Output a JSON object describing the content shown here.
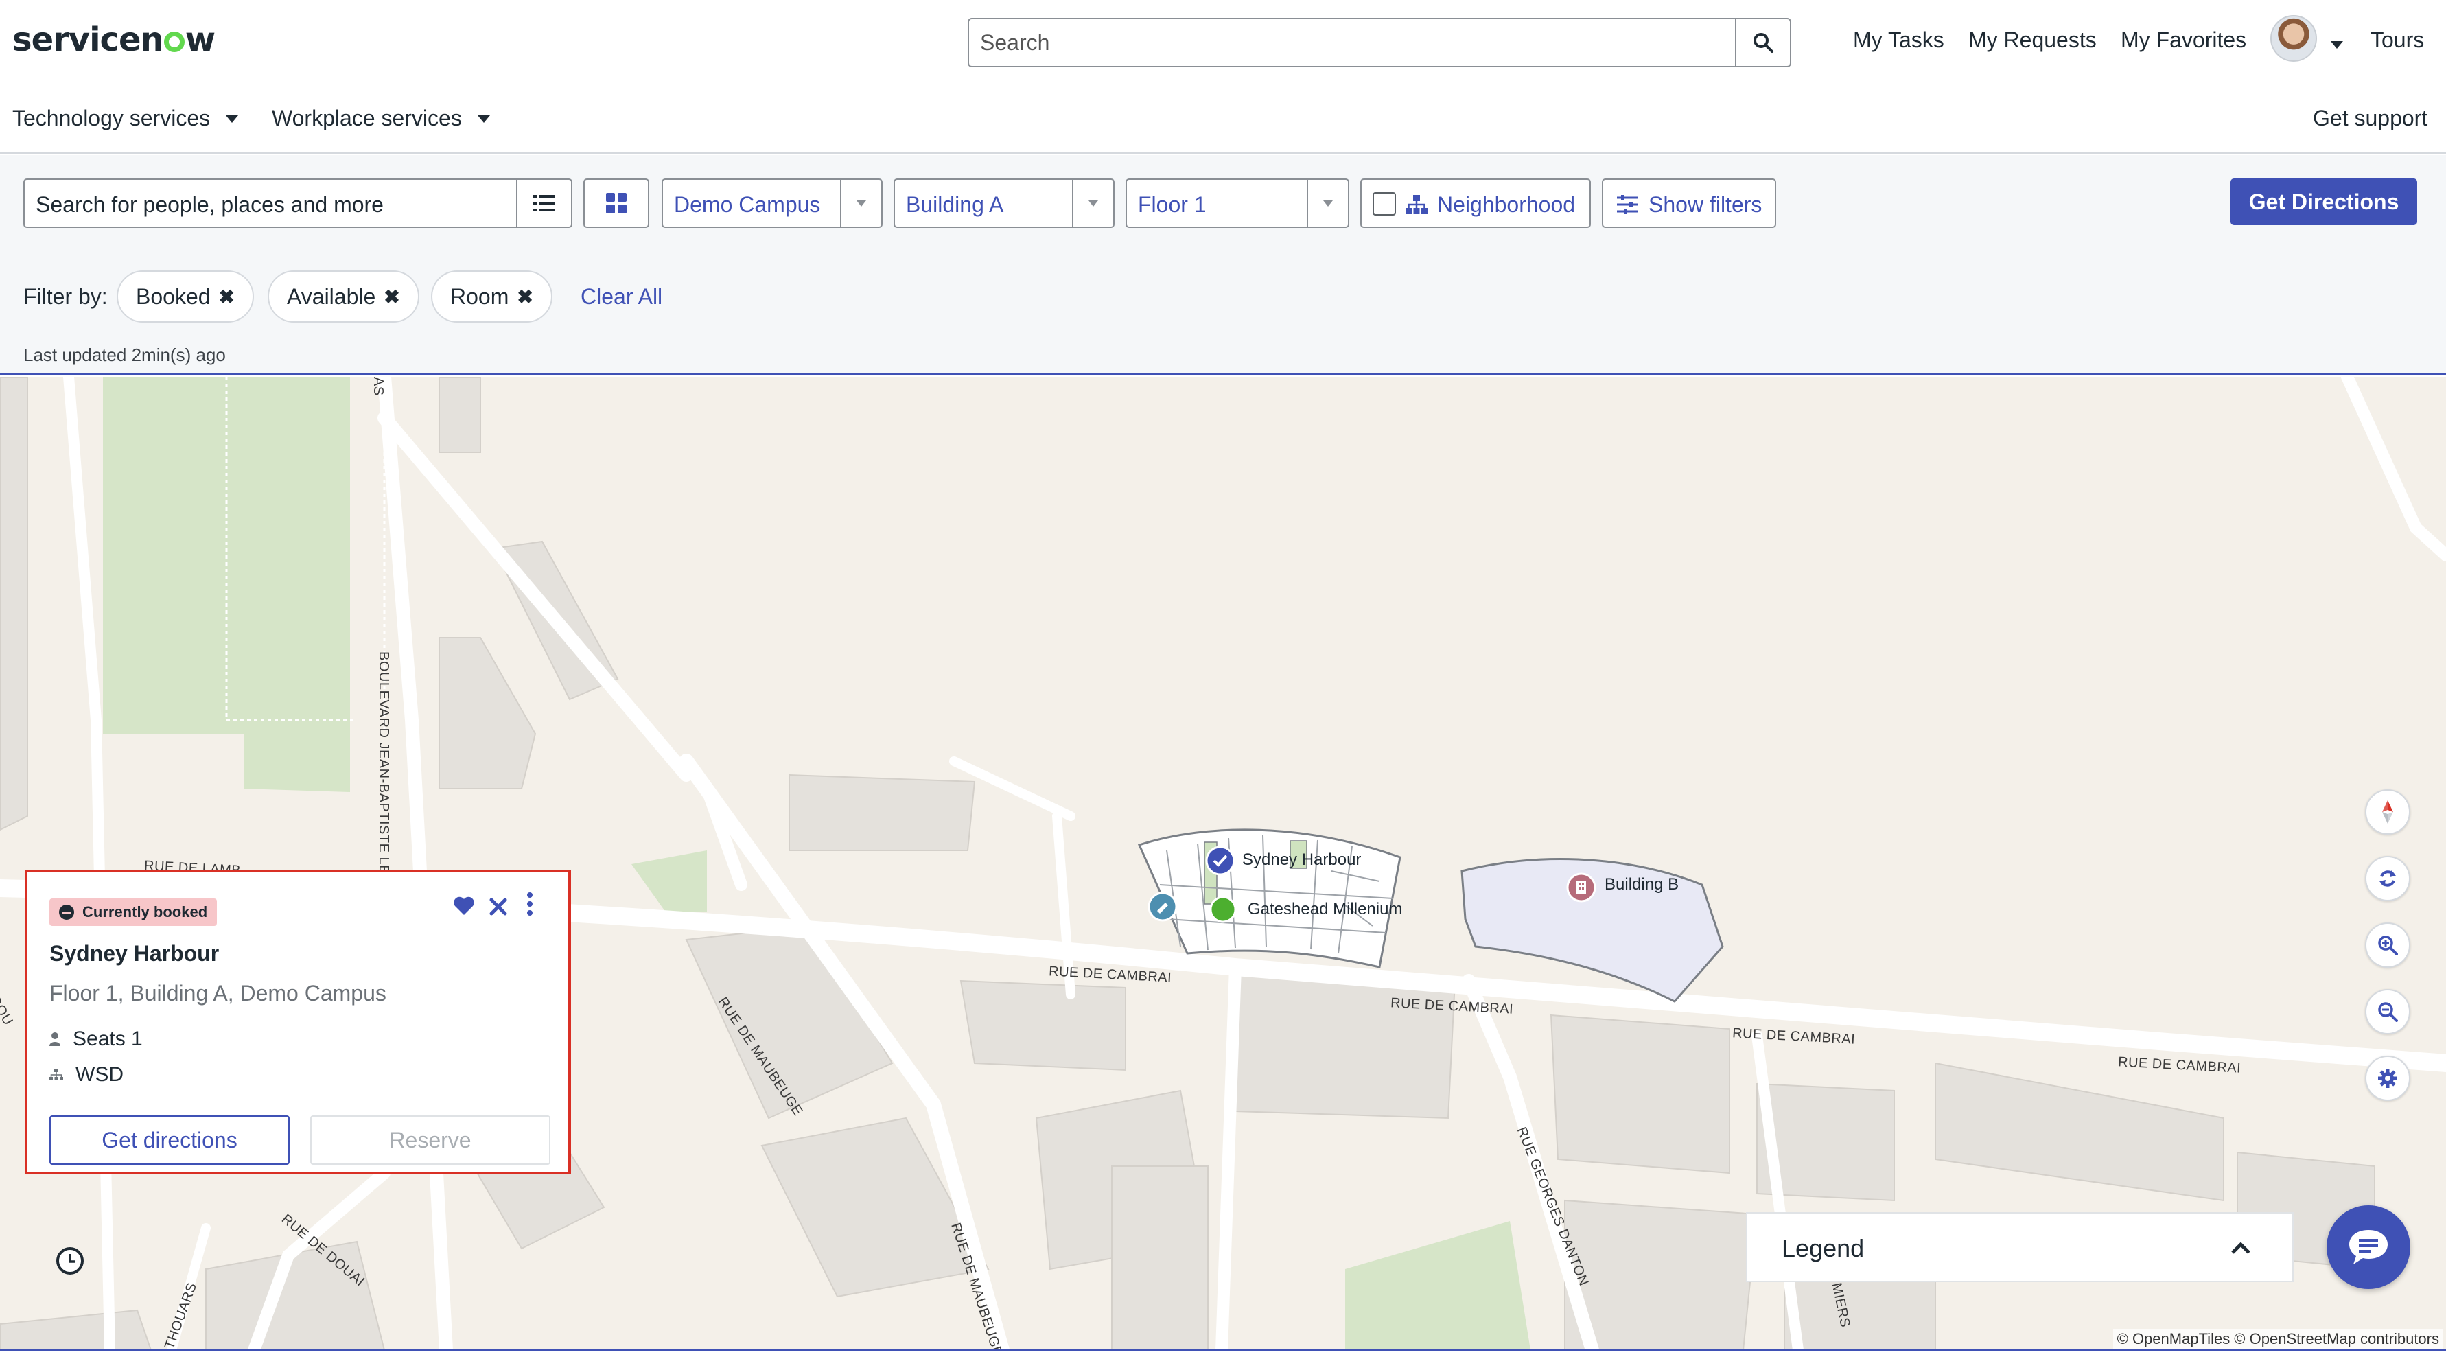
{
  "header": {
    "logo": "servicenow",
    "search_placeholder": "Search",
    "links": [
      "My Tasks",
      "My Requests",
      "My Favorites"
    ],
    "tours": "Tours"
  },
  "nav": {
    "technology_services": "Technology services",
    "workplace_services": "Workplace services",
    "get_support": "Get support"
  },
  "toolbar": {
    "search_label": "Search for people, places and more",
    "campus": "Demo Campus",
    "building": "Building A",
    "floor": "Floor 1",
    "neighborhood": "Neighborhood",
    "show_filters": "Show filters",
    "get_directions": "Get Directions"
  },
  "filters": {
    "label": "Filter by:",
    "chips": [
      "Booked",
      "Available",
      "Room"
    ],
    "clear_all": "Clear All",
    "last_updated": "Last updated 2min(s) ago"
  },
  "map": {
    "places": {
      "sydney_harbour": "Sydney Harbour",
      "gateshead": "Gateshead Millenium",
      "building_b": "Building B"
    },
    "streets": {
      "cambrai1": "RUE DE CAMBRAI",
      "cambrai2": "RUE DE CAMBRAI",
      "cambrai3": "RUE DE CAMBRAI",
      "cambrai4": "RUE DE CAMBRAI",
      "maubeuge1": "RUE DE MAUBEUGE",
      "maubeuge2": "RUE DE MAUBEUGE",
      "boulevard": "BOULEVARD JEAN-BAPTISTE LEBAS",
      "danton": "RUE GEORGES DANTON",
      "douai": "RUE DE DOUAI",
      "thouars": "THOUARS",
      "amiers": "MIERS",
      "ruede": "RUE DE LAMB",
      "as": "AS",
      "dou": "DOU"
    },
    "attribution": "© OpenMapTiles © OpenStreetMap contributors",
    "legend": "Legend"
  },
  "card": {
    "badge": "Currently booked",
    "title": "Sydney Harbour",
    "location": "Floor 1, Building A, Demo Campus",
    "seats": "Seats 1",
    "type": "WSD",
    "get_directions": "Get directions",
    "reserve": "Reserve"
  },
  "colors": {
    "primary": "#3f51b5",
    "highlight_border": "#d93025",
    "booked_badge": "#f7c6c9",
    "available_dot": "#4caf2f",
    "logo_accent": "#62d84e"
  }
}
